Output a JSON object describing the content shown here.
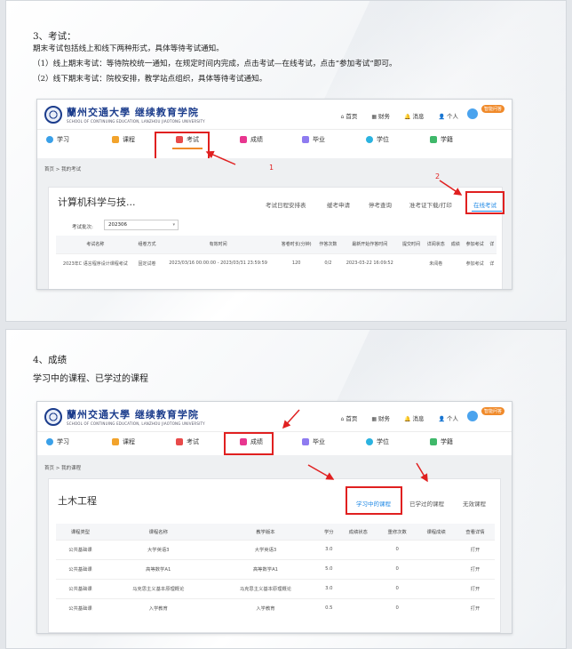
{
  "section3": {
    "heading": "3、考试：",
    "intro": "期末考试包括线上和线下两种形式，具体等待考试通知。",
    "line1": "（1）线上期末考试：等待院校统一通知，在规定时间内完成，点击考试—在线考试，点击“参加考试”即可。",
    "line2": "（2）线下期末考试：院校安排，教学站点组织，具体等待考试通知。"
  },
  "section4": {
    "heading": "4、成绩",
    "subheading": "学习中的课程、已学过的课程"
  },
  "portal": {
    "logo_main": "蘭州交通大學 继续教育学院",
    "logo_sub": "SCHOOL OF CONTINUING EDUCATION, LANZHOU JIAOTONG UNIVERSITY",
    "top_links": [
      "首页",
      "财务",
      "消息",
      "个人"
    ],
    "help_badge": "智能问答",
    "nav": [
      "学习",
      "课程",
      "考试",
      "成绩",
      "毕业",
      "学位",
      "学籍"
    ]
  },
  "shot1": {
    "breadcrumb": "首页 > 我的考试",
    "course_title": "计算机科学与技...",
    "tabs": [
      "考试日程安排表",
      "缓考申请",
      "停考查询",
      "准考证下载/打印",
      "在线考试"
    ],
    "filter_label": "考试批次:",
    "filter_value": "202306",
    "columns": [
      "考试名称",
      "组卷方式",
      "有效时间",
      "答卷时长(分钟)",
      "作答次数",
      "最新开始作答时间",
      "提交时间",
      "详阅状态",
      "成绩",
      "参加考试",
      "详"
    ],
    "rows": [
      [
        "2023年C 语言程序设计课程考试",
        "固定试卷",
        "2023/03/16 00:00:00 - 2023/03/31 23:59:59",
        "120",
        "0/2",
        "2023-03-22 16:09:52",
        "",
        "未阅卷",
        "",
        "参加考试",
        "详"
      ]
    ],
    "annotations": [
      "1",
      "2"
    ]
  },
  "shot2": {
    "breadcrumb": "首页 > 我的课程",
    "course_title": "土木工程",
    "tabs": [
      "学习中的课程",
      "已学过的课程",
      "无效课程"
    ],
    "columns": [
      "课程类型",
      "课程名称",
      "教学版本",
      "学分",
      "成绩状态",
      "重修次数",
      "课程成绩",
      "查看详情"
    ],
    "rows": [
      [
        "公共基础课",
        "大学英语3",
        "大学英语3",
        "3.0",
        "",
        "0",
        "",
        "打开"
      ],
      [
        "公共基础课",
        "高等数学A1",
        "高等数学A1",
        "5.0",
        "",
        "0",
        "",
        "打开"
      ],
      [
        "公共基础课",
        "马克思主义基本原理概论",
        "马克思主义基本原理概论",
        "3.0",
        "",
        "0",
        "",
        "打开"
      ],
      [
        "公共基础课",
        "入学教育",
        "入学教育",
        "0.5",
        "",
        "0",
        "",
        "打开"
      ]
    ]
  },
  "colors": {
    "accent_blue": "#1e88e5",
    "highlight_red": "#e02020",
    "brand_navy": "#1b3c8c",
    "active_orange": "#f08a2a"
  }
}
